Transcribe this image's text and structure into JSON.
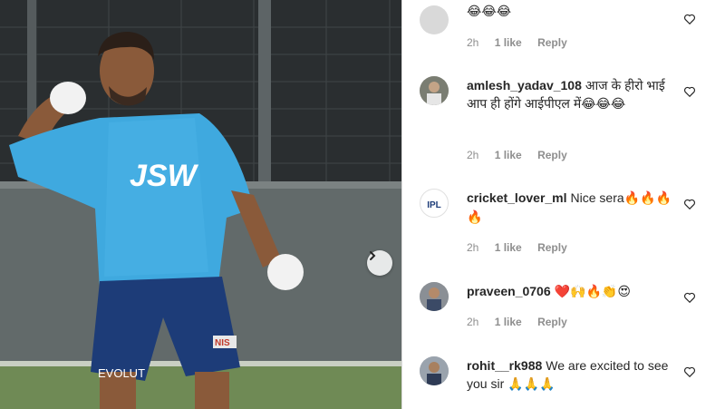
{
  "post": {
    "next_icon": "chevron-right-icon",
    "jersey_text": "JSW",
    "shorts_text": "EVOLUT",
    "shorts_brand": "NIS"
  },
  "comments": [
    {
      "username": "",
      "text": "",
      "emojis": "😂😂😂",
      "time": "2h",
      "likes": "1 like",
      "reply": "Reply"
    },
    {
      "username": "amlesh_yadav_108",
      "text": "आज के हीरो भाई आप ही होंगे आईपीएल में",
      "emojis": "😂😂😂",
      "time": "2h",
      "likes": "1 like",
      "reply": "Reply"
    },
    {
      "username": "cricket_lover_ml",
      "text": "Nice sera",
      "emojis": "🔥🔥🔥🔥",
      "time": "2h",
      "likes": "1 like",
      "reply": "Reply",
      "avatar_text": "IPL"
    },
    {
      "username": "praveen_0706",
      "text": "",
      "emojis": "❤️🙌🔥👏😍",
      "time": "2h",
      "likes": "1 like",
      "reply": "Reply"
    },
    {
      "username": "rohit__rk988",
      "text": "We are excited to see you sir",
      "emojis": "🙏🙏🙏",
      "time": "",
      "likes": "",
      "reply": ""
    }
  ],
  "colors": {
    "text": "#262626",
    "meta": "#8e8e8e",
    "jersey": "#3fa9df",
    "shorts": "#1d3c78"
  }
}
